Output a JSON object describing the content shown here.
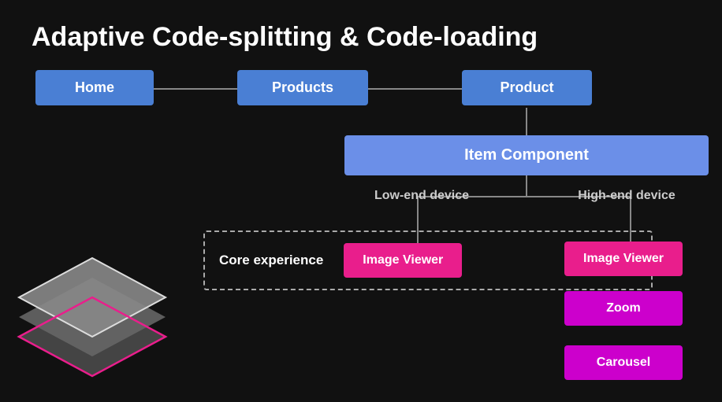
{
  "title": "Adaptive Code-splitting & Code-loading",
  "nodes": {
    "home": "Home",
    "products": "Products",
    "product": "Product",
    "item_component": "Item Component"
  },
  "device_labels": {
    "low": "Low-end device",
    "high": "High-end device"
  },
  "core_label": "Core experience",
  "image_viewer": "Image Viewer",
  "zoom": "Zoom",
  "carousel": "Carousel",
  "colors": {
    "route_node": "#4a7fd4",
    "item_component": "#6b8fe8",
    "image_viewer_pink": "#e91e8c",
    "zoom_purple": "#cc00cc",
    "carousel_purple": "#cc00cc",
    "connector": "#888888",
    "dashed_border": "#aaaaaa",
    "bg": "#111111"
  }
}
